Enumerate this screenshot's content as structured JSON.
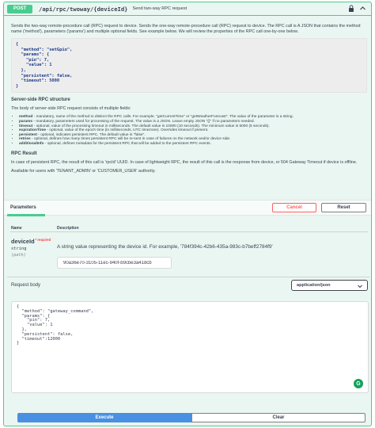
{
  "operation": {
    "method": "POST",
    "path": "/api/rpc/twoway/{deviceId}",
    "summary": "Send two-way RPC request"
  },
  "description": {
    "intro": "Sends the two-way remote-procedure call (RPC) request to device. Sends the one-way remote-procedure call (RPC) request to device. The RPC call is A JSON that contains the method name ('method'), parameters ('params') and multiple optional fields. See example below. We will review the properties of the RPC call one-by-one below.",
    "example_code": "{\n  \"method\": \"setGpio\",\n  \"params\": {\n    \"pin\": 7,\n    \"value\": 1\n  },\n  \"persistent\": false,\n  \"timeout\": 5000\n}",
    "structure_title": "Server-side RPC structure",
    "structure_intro": "The body of server-side RPC request consists of multiple fields:",
    "fields": [
      {
        "name": "method",
        "text": " - mandatory, name of the method to distinct the RPC calls. For example, \"getCurrentTime\" or \"getWeatherForecast\". The value of the parameter is a string."
      },
      {
        "name": "params",
        "text": " - mandatory, parameters used for processing of the request. The value is a JSON. Leave empty JSON \"{}\" if no parameters needed."
      },
      {
        "name": "timeout",
        "text": " - optional, value of the processing timeout in milliseconds. The default value is 10000 (10 seconds). The minimum value is 5000 (5 seconds)."
      },
      {
        "name": "expirationTime",
        "text": " - optional, value of the epoch time (in milliseconds, UTC timezone). Overrides timeout if present."
      },
      {
        "name": "persistent",
        "text": " - optional, indicates persistent RPC. The default value is \"false\"."
      },
      {
        "name": "retries",
        "text": " - optional, defines how many times persistent RPC will be re-sent in case of failures on the network and/or device side."
      },
      {
        "name": "additionalInfo",
        "text": " - optional, defines metadata for the persistent RPC that will be added to the persistent RPC events."
      }
    ],
    "result_title": "RPC Result",
    "result_text": "In case of persistent RPC, the result of this call is 'rpcId' UUID. In case of lightweight RPC, the result of this call is the response from device, or 504 Gateway Timeout if device is offline.",
    "availability": "Available for users with 'TENANT_ADMIN' or 'CUSTOMER_USER' authority."
  },
  "parameters": {
    "tab_label": "Parameters",
    "cancel_label": "Cancel",
    "reset_label": "Reset",
    "col_name": "Name",
    "col_description": "Description",
    "param": {
      "name": "deviceId",
      "required_mark": "* required",
      "type": "string",
      "in": "(path)",
      "description": "A string value representing the device id. For example, '784f394c-42b6-435a-983c-b7beff2784f9'",
      "value": "90a36e70-3105-11ec-940f-b9cbe3a418cb"
    }
  },
  "request_body": {
    "label": "Request body",
    "content_type": "application/json",
    "value": "{\n  \"method\": \"gateway_command\",\n  \"params\": {\n    \"pin\": 7,\n    \"value\": 1\n  },\n  \"persistent\": false,\n  \"timeout\":12000\n}",
    "badge": "G"
  },
  "actions": {
    "execute_label": "Execute",
    "clear_label": "Clear"
  },
  "colors": {
    "post_green": "#49cc90",
    "execute_blue": "#4990e2",
    "cancel_red": "#ff6060"
  }
}
